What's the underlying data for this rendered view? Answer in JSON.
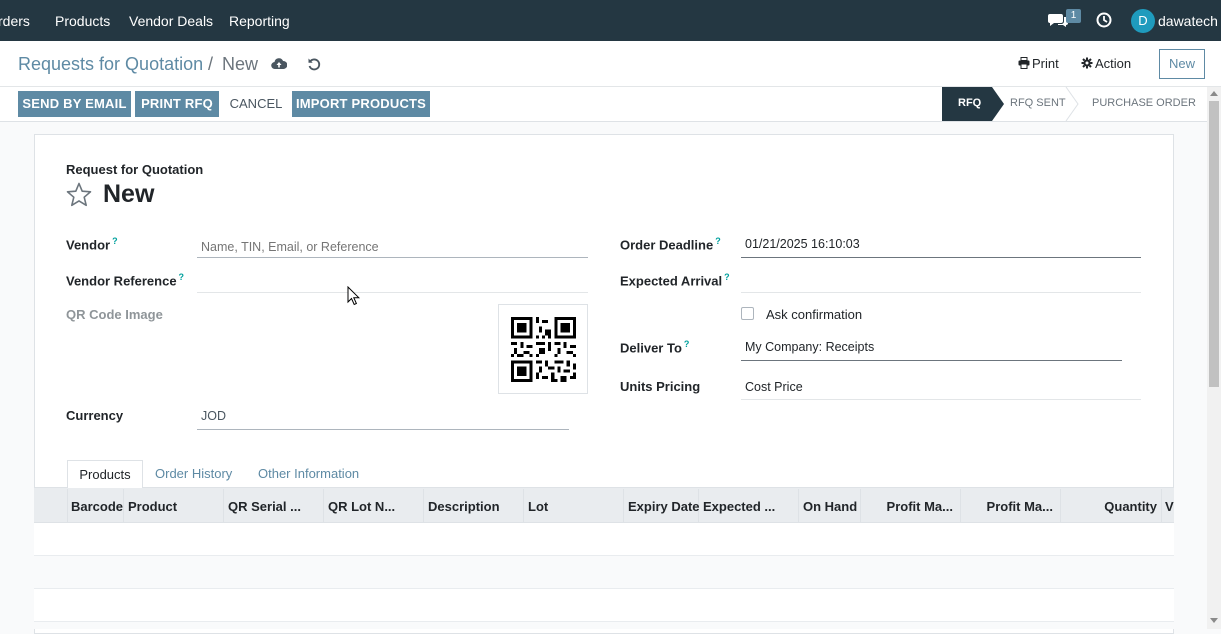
{
  "topnav": {
    "items": [
      "rders",
      "Products",
      "Vendor Deals",
      "Reporting"
    ],
    "message_count": "1",
    "user_initial": "D",
    "user_name": "dawatech"
  },
  "control_panel": {
    "breadcrumb_parent": "Requests for Quotation",
    "breadcrumb_sep": "/",
    "breadcrumb_current": "New",
    "print_label": "Print",
    "action_label": "Action",
    "new_label": "New"
  },
  "action_bar": {
    "buttons": [
      "SEND BY EMAIL",
      "PRINT RFQ",
      "CANCEL",
      "IMPORT PRODUCTS"
    ],
    "status_steps": [
      "RFQ",
      "RFQ SENT",
      "PURCHASE ORDER"
    ],
    "active_step": "RFQ"
  },
  "form": {
    "doc_type": "Request for Quotation",
    "title": "New",
    "vendor_label": "Vendor",
    "vendor_placeholder": "Name, TIN, Email, or Reference",
    "vendor_ref_label": "Vendor Reference",
    "vendor_ref_value": "",
    "qr_label": "QR Code Image",
    "currency_label": "Currency",
    "currency_value": "JOD",
    "order_deadline_label": "Order Deadline",
    "order_deadline_value": "01/21/2025 16:10:03",
    "expected_arrival_label": "Expected Arrival",
    "expected_arrival_value": "",
    "ask_confirmation_label": "Ask confirmation",
    "ask_confirmation_checked": false,
    "deliver_to_label": "Deliver To",
    "deliver_to_value": "My Company: Receipts",
    "units_pricing_label": "Units Pricing",
    "units_pricing_value": "Cost Price",
    "help_mark": "?"
  },
  "tabs": [
    "Products",
    "Order History",
    "Other Information"
  ],
  "active_tab": "Products",
  "table": {
    "columns": [
      "Barcode",
      "Product",
      "QR Serial ...",
      "QR Lot N...",
      "Description",
      "Lot",
      "Expiry Date",
      "Expected ...",
      "On Hand",
      "Profit Ma...",
      "Profit Ma...",
      "Quantity",
      "V"
    ],
    "rows": []
  },
  "colors": {
    "navbar": "#243742",
    "primary_button": "#5e8aa4",
    "active_step": "#243742",
    "accent": "#00a09d",
    "avatar": "#1f9bbd"
  }
}
